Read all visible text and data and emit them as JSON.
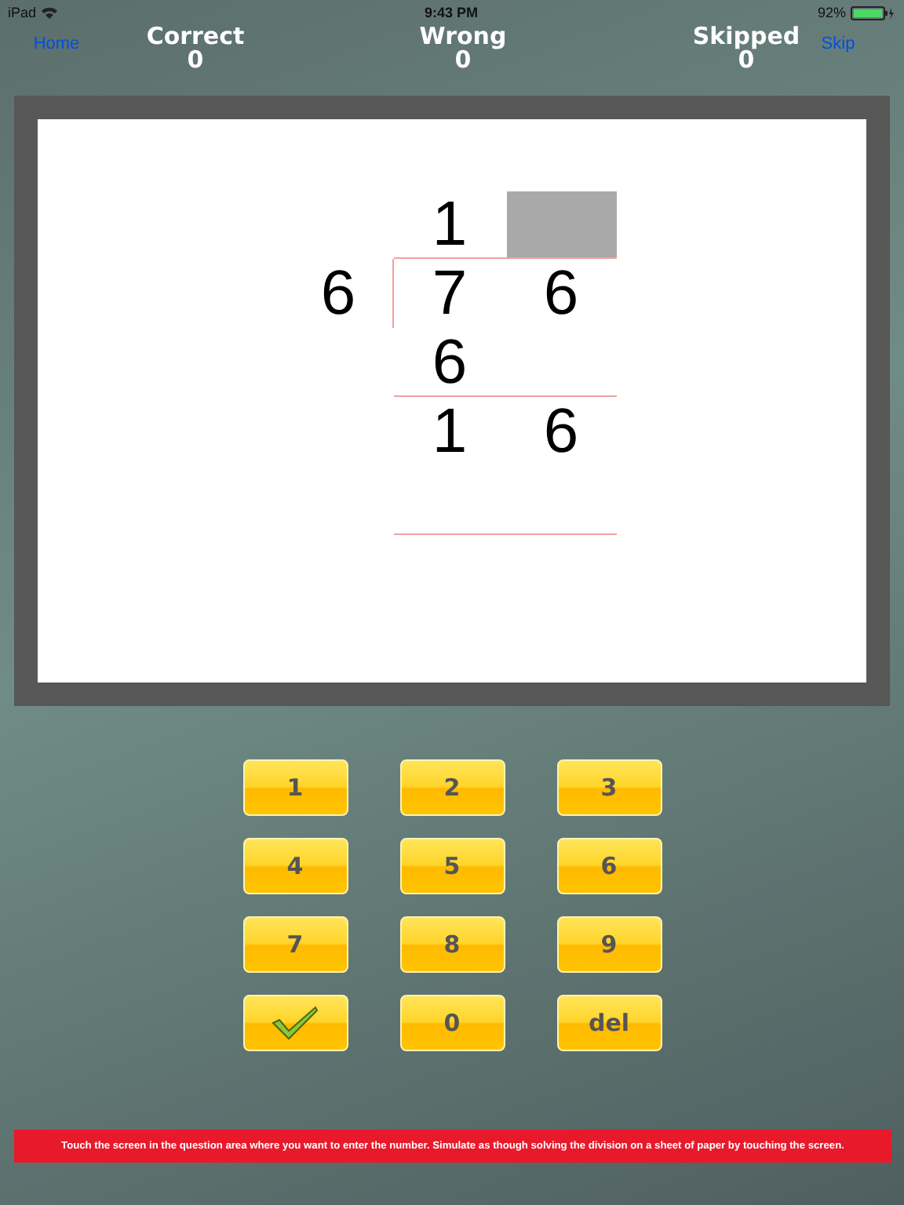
{
  "status_bar": {
    "device": "iPad",
    "time": "9:43 PM",
    "battery": "92%"
  },
  "nav": {
    "home": "Home",
    "skip": "Skip"
  },
  "scores": [
    {
      "label": "Correct",
      "value": "0"
    },
    {
      "label": "Wrong",
      "value": "0"
    },
    {
      "label": "Skipped",
      "value": "0"
    }
  ],
  "division": {
    "rows": [
      {
        "cells": [
          {
            "kind": "digit",
            "text": "1"
          },
          {
            "kind": "input",
            "selected": true
          }
        ],
        "rule_below": true
      },
      {
        "divisor": "6",
        "cells": [
          {
            "kind": "digit",
            "text": "7"
          },
          {
            "kind": "digit",
            "text": "6"
          }
        ],
        "rule_below": false
      },
      {
        "cells": [
          {
            "kind": "digit",
            "text": "6"
          },
          {
            "kind": "empty"
          }
        ],
        "rule_below": true
      },
      {
        "cells": [
          {
            "kind": "digit",
            "text": "1"
          },
          {
            "kind": "digit",
            "text": "6"
          }
        ],
        "rule_below": false
      },
      {
        "cells": [
          {
            "kind": "empty"
          },
          {
            "kind": "empty"
          }
        ],
        "rule_below": true
      }
    ]
  },
  "keypad": [
    {
      "kind": "text",
      "label": "1"
    },
    {
      "kind": "text",
      "label": "2"
    },
    {
      "kind": "text",
      "label": "3"
    },
    {
      "kind": "text",
      "label": "4"
    },
    {
      "kind": "text",
      "label": "5"
    },
    {
      "kind": "text",
      "label": "6"
    },
    {
      "kind": "text",
      "label": "7"
    },
    {
      "kind": "text",
      "label": "8"
    },
    {
      "kind": "text",
      "label": "9"
    },
    {
      "kind": "check"
    },
    {
      "kind": "text",
      "label": "0"
    },
    {
      "kind": "text",
      "label": "del"
    }
  ],
  "hint": "Touch the screen in the question area where you want to enter the number. Simulate as though solving the division on a sheet of paper by touching the screen."
}
